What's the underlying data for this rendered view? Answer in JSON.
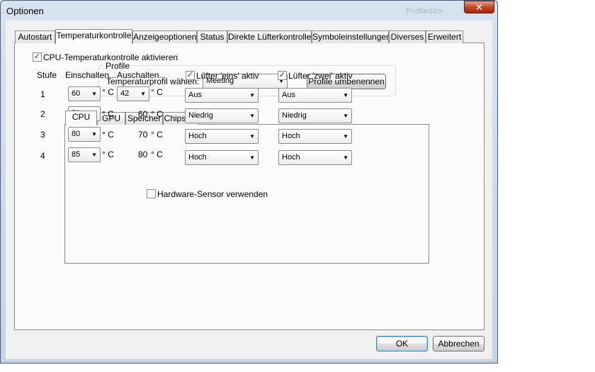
{
  "window": {
    "title": "Optionen",
    "ghost_title": "Profileditor",
    "close_glyph": "✕"
  },
  "tabs": [
    {
      "label": "Autostart",
      "active": false
    },
    {
      "label": "Temperaturkontrolle",
      "active": true
    },
    {
      "label": "Anzeigeoptionen",
      "active": false
    },
    {
      "label": "Status",
      "active": false
    },
    {
      "label": "Direkte Lüfterkontrolle",
      "active": false
    },
    {
      "label": "Symboleinstellungen",
      "active": false
    },
    {
      "label": "Diverses",
      "active": false
    },
    {
      "label": "Erweitert",
      "active": false
    }
  ],
  "profile": {
    "group_label": "Profile",
    "select_label": "Temperaturprofil wählen:",
    "selected": "Meeting",
    "rename_button": "Profile umbenennen"
  },
  "inner_tabs": [
    {
      "label": "CPU",
      "active": true
    },
    {
      "label": "GPU",
      "active": false
    },
    {
      "label": "Speicher",
      "active": false
    },
    {
      "label": "Chipsatz",
      "active": false
    }
  ],
  "cpu": {
    "enable_label": "CPU-Temperaturkontrolle aktivieren",
    "enable_checked": true,
    "headers": {
      "stufe": "Stufe",
      "on": "Einschalten...",
      "off": "Auschalten..."
    },
    "fan1_label": "Lüfter 'eins' aktiv",
    "fan1_checked": true,
    "fan2_label": "Lüfter 'zwei' aktiv",
    "fan2_checked": true,
    "unit": "° C",
    "rows": [
      {
        "stufe": "1",
        "on": "60",
        "off": "42",
        "off_is_combo": true,
        "fan1": "Aus",
        "fan2": "Aus"
      },
      {
        "stufe": "2",
        "on": "70",
        "off": "60",
        "off_is_combo": false,
        "fan1": "Niedrig",
        "fan2": "Niedrig"
      },
      {
        "stufe": "3",
        "on": "80",
        "off": "70",
        "off_is_combo": false,
        "fan1": "Hoch",
        "fan2": "Hoch"
      },
      {
        "stufe": "4",
        "on": "85",
        "off": "80",
        "off_is_combo": false,
        "fan1": "Hoch",
        "fan2": "Hoch"
      }
    ]
  },
  "hardware_sensor": {
    "label": "Hardware-Sensor verwenden",
    "checked": false
  },
  "buttons": {
    "ok": "OK",
    "cancel": "Abbrechen"
  },
  "icons": {
    "dropdown": "▼",
    "check": "✓"
  }
}
